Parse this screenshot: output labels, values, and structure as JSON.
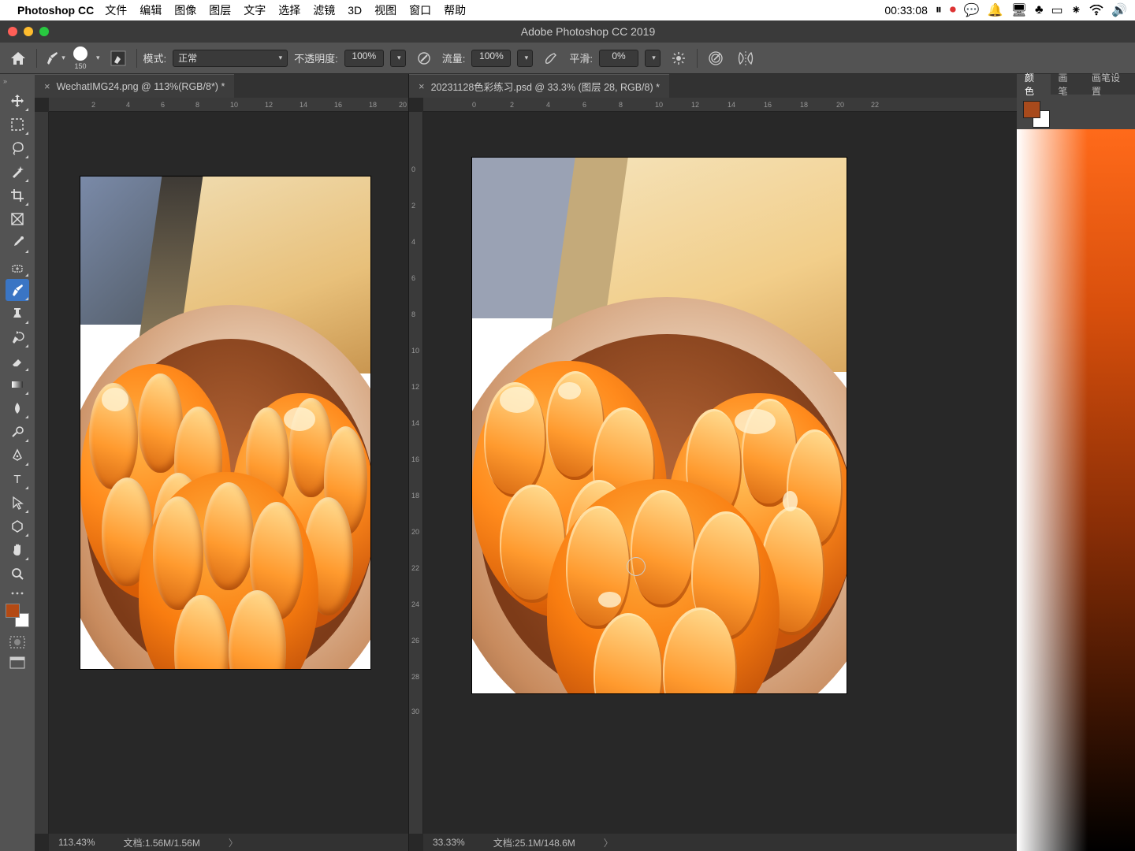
{
  "menubar": {
    "app": "Photoshop CC",
    "items": [
      "文件",
      "编辑",
      "图像",
      "图层",
      "文字",
      "选择",
      "滤镜",
      "3D",
      "视图",
      "窗口",
      "帮助"
    ],
    "clock": "00:33:08"
  },
  "window": {
    "title": "Adobe Photoshop CC 2019"
  },
  "options": {
    "brush_size": "150",
    "mode_label": "模式:",
    "mode_value": "正常",
    "opacity_label": "不透明度:",
    "opacity_value": "100%",
    "flow_label": "流量:",
    "flow_value": "100%",
    "smoothing_label": "平滑:",
    "smoothing_value": "0%"
  },
  "tabs": {
    "left": "WechatIMG24.png @ 113%(RGB/8*) *",
    "right": "20231128色彩练习.psd @ 33.3% (图层 28, RGB/8) *"
  },
  "status": {
    "left_zoom": "113.43%",
    "left_doc": "文档:1.56M/1.56M",
    "right_zoom": "33.33%",
    "right_doc": "文档:25.1M/148.6M"
  },
  "rulers": {
    "left_h": [
      "2",
      "4",
      "6",
      "8",
      "10",
      "12",
      "14",
      "16",
      "18",
      "20"
    ],
    "right_h": [
      "0",
      "2",
      "4",
      "6",
      "8",
      "10",
      "12",
      "14",
      "16",
      "18",
      "20",
      "22"
    ],
    "right_v": [
      "0",
      "2",
      "4",
      "6",
      "8",
      "10",
      "12",
      "14",
      "16",
      "18",
      "20",
      "22",
      "24",
      "26",
      "28",
      "30"
    ]
  },
  "panels": {
    "tabs": [
      "颜色",
      "画笔",
      "画笔设置"
    ],
    "fg_color": "#a84a1c"
  },
  "colors": {
    "fg": "#b44a14"
  }
}
